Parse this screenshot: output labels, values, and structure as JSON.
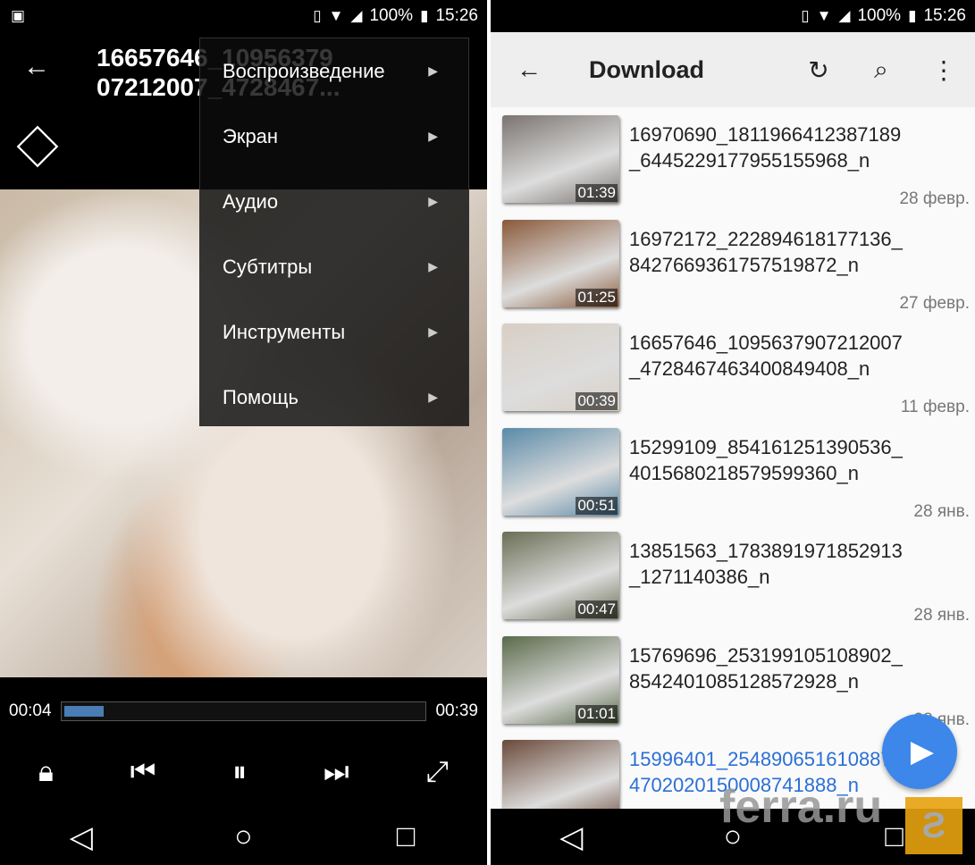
{
  "status": {
    "battery": "100%",
    "time": "15:26"
  },
  "player": {
    "title_line1": "16657646_10956379",
    "title_line2": "07212007_4728467...",
    "menu": [
      {
        "label": "Воспроизведение"
      },
      {
        "label": "Экран"
      },
      {
        "label": "Аудио"
      },
      {
        "label": "Субтитры"
      },
      {
        "label": "Инструменты"
      },
      {
        "label": "Помощь"
      }
    ],
    "elapsed": "00:04",
    "duration": "00:39",
    "progress_fraction": 0.11
  },
  "browser": {
    "title": "Download",
    "items": [
      {
        "name": "16970690_1811966412387189_6445229177955155968_n",
        "duration": "01:39",
        "date": "28 февр.",
        "thumb": "#7a7470"
      },
      {
        "name": "16972172_222894618177136_8427669361757519872_n",
        "duration": "01:25",
        "date": "27 февр.",
        "thumb": "#8a5a3a"
      },
      {
        "name": "16657646_1095637907212007_4728467463400849408_n",
        "duration": "00:39",
        "date": "11 февр.",
        "thumb": "#d8cfc4"
      },
      {
        "name": "15299109_854161251390536_4015680218579599360_n",
        "duration": "00:51",
        "date": "28 янв.",
        "thumb": "#5a8aa8"
      },
      {
        "name": "13851563_1783891971852913_1271140386_n",
        "duration": "00:47",
        "date": "28 янв.",
        "thumb": "#6b6e55"
      },
      {
        "name": "15769696_253199105108902_8542401085128572928_n",
        "duration": "01:01",
        "date": "28 янв.",
        "thumb": "#5a6a4a"
      },
      {
        "name": "15996401_254890651610887_4702020150008741888_n",
        "duration": "",
        "date": "",
        "thumb": "#6a4a3a",
        "active": true
      }
    ]
  },
  "watermark": "ferra.ru"
}
